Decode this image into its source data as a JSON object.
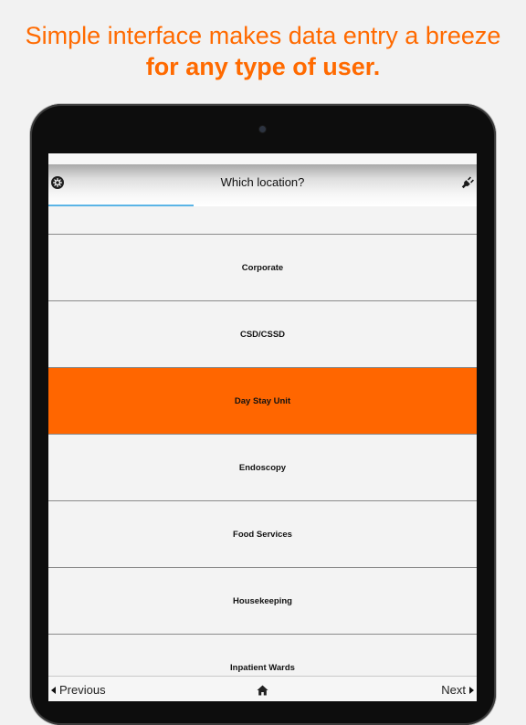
{
  "marketing": {
    "line1": "Simple interface makes data entry a breeze",
    "line2": "for any type of user.",
    "accent_color": "#ff6a00"
  },
  "navbar": {
    "title": "Which location?",
    "left_icon": "settings-gear-icon",
    "right_icon": "plug-icon"
  },
  "progress": {
    "fraction": 0.34,
    "color": "#5ab4e6"
  },
  "locations": {
    "selected_color": "#ff6600",
    "items": [
      {
        "label": "Corporate",
        "selected": false
      },
      {
        "label": "CSD/CSSD",
        "selected": false
      },
      {
        "label": "Day Stay Unit",
        "selected": true
      },
      {
        "label": "Endoscopy",
        "selected": false
      },
      {
        "label": "Food Services",
        "selected": false
      },
      {
        "label": "Housekeeping",
        "selected": false
      },
      {
        "label": "Inpatient Wards",
        "selected": false
      }
    ]
  },
  "toolbar": {
    "previous_label": "Previous",
    "next_label": "Next",
    "home_icon": "home-icon"
  }
}
